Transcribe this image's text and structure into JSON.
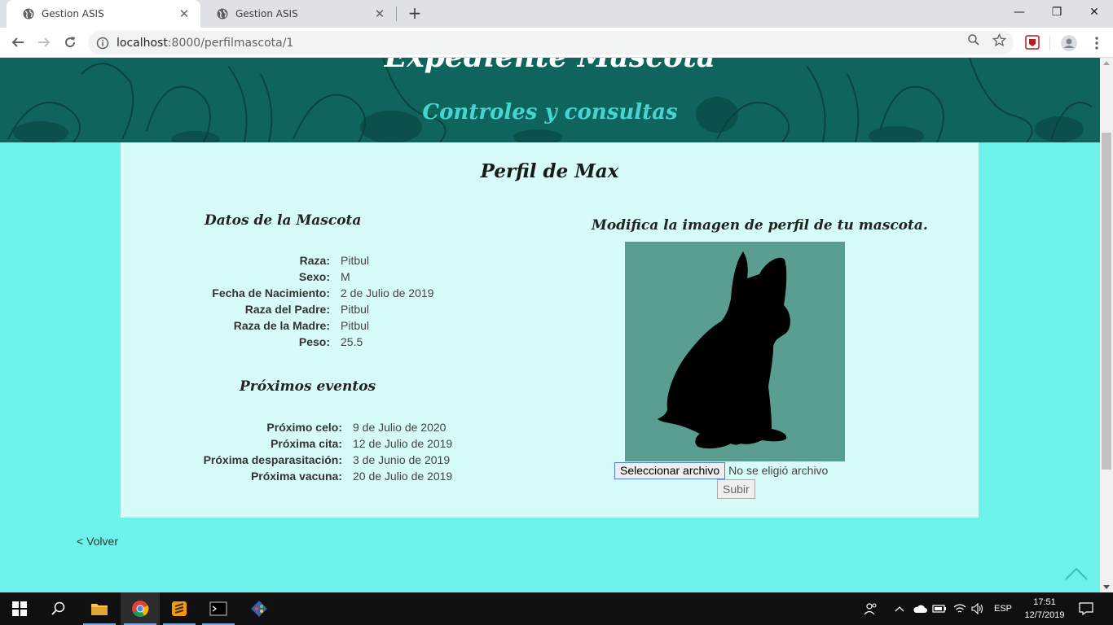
{
  "browser": {
    "tabs": [
      {
        "title": "Gestion ASIS",
        "active": true,
        "icon": "globe-icon"
      },
      {
        "title": "Gestion ASIS",
        "active": false,
        "icon": "globe-icon"
      }
    ],
    "url_host": "localhost",
    "url_path": ":8000/perfilmascota/1",
    "window_controls": {
      "minimize": "—",
      "restore": "❐",
      "close": "✕"
    }
  },
  "banner": {
    "title": "Expediente Mascota",
    "subtitle": "Controles y consultas"
  },
  "profile": {
    "title": "Perfil de Max",
    "pet_data_title": "Datos de la Mascota",
    "pet_data": [
      {
        "label": "Raza:",
        "value": "Pitbul"
      },
      {
        "label": "Sexo:",
        "value": "M"
      },
      {
        "label": "Fecha de Nacimiento:",
        "value": "2 de Julio de 2019"
      },
      {
        "label": "Raza del Padre:",
        "value": "Pitbul"
      },
      {
        "label": "Raza de la Madre:",
        "value": "Pitbul"
      },
      {
        "label": "Peso:",
        "value": "25.5"
      }
    ],
    "events_title": "Próximos eventos",
    "events": [
      {
        "label": "Próximo celo:",
        "value": "9 de Julio de 2020"
      },
      {
        "label": "Próxima cita:",
        "value": "12 de Julio de 2019"
      },
      {
        "label": "Próxima desparasitación:",
        "value": "3 de Junio de 2019"
      },
      {
        "label": "Próxima vacuna:",
        "value": "20 de Julio de 2019"
      }
    ],
    "image_title": "Modifica la imagen de perfil de tu mascota.",
    "file_button": "Seleccionar archivo",
    "file_status": "No se eligió archivo",
    "submit_label": "Subir"
  },
  "back_link": "< Volver",
  "taskbar": {
    "language": "ESP",
    "time": "17:51",
    "date": "12/7/2019"
  },
  "colors": {
    "page_bg": "#6ef2ec",
    "card_bg": "#d6fbf9",
    "banner_bg": "#0f655e",
    "subtitle": "#44d6cf",
    "image_bg": "#5a9e91"
  }
}
